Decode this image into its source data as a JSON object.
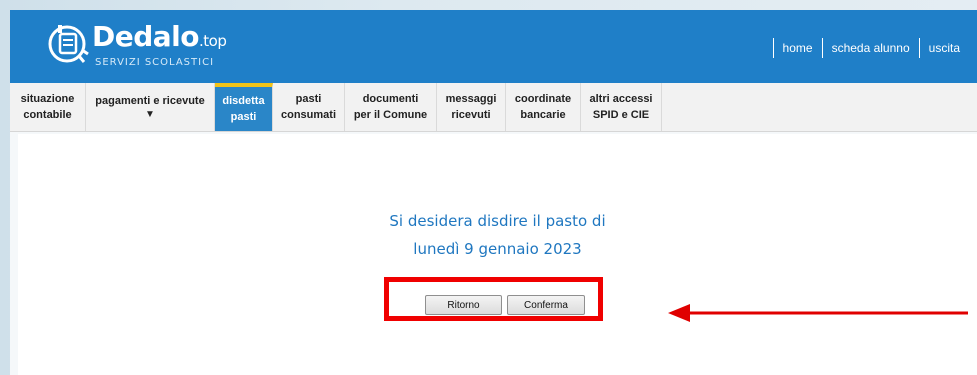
{
  "header": {
    "brand": "Dedalo",
    "brand_suffix": ".top",
    "subtitle": "SERVIZI SCOLASTICI",
    "bg_color": "#1f7fc8",
    "links": [
      {
        "label": "home"
      },
      {
        "label": "scheda alunno"
      },
      {
        "label": "uscita"
      }
    ]
  },
  "nav": {
    "active_color": "#2a86c8",
    "active_border_color": "#f2c318",
    "items": [
      {
        "line1": "situazione",
        "line2": "contabile"
      },
      {
        "line1": "pagamenti e ricevute",
        "line2": "▼"
      },
      {
        "line1": "disdetta",
        "line2": "pasti",
        "active": true
      },
      {
        "line1": "pasti",
        "line2": "consumati"
      },
      {
        "line1": "documenti",
        "line2": "per il Comune"
      },
      {
        "line1": "messaggi",
        "line2": "ricevuti"
      },
      {
        "line1": "coordinate",
        "line2": "bancarie"
      },
      {
        "line1": "altri accessi",
        "line2": "SPID e CIE"
      }
    ]
  },
  "main": {
    "question_line1": "Si desidera disdire il pasto di",
    "question_line2": "lunedì 9 gennaio 2023",
    "back_label": "Ritorno",
    "confirm_label": "Conferma",
    "highlight_color": "#f00000"
  },
  "icons": {
    "logo": "dedalo-logo-icon",
    "annotation": "red-arrow-icon"
  }
}
